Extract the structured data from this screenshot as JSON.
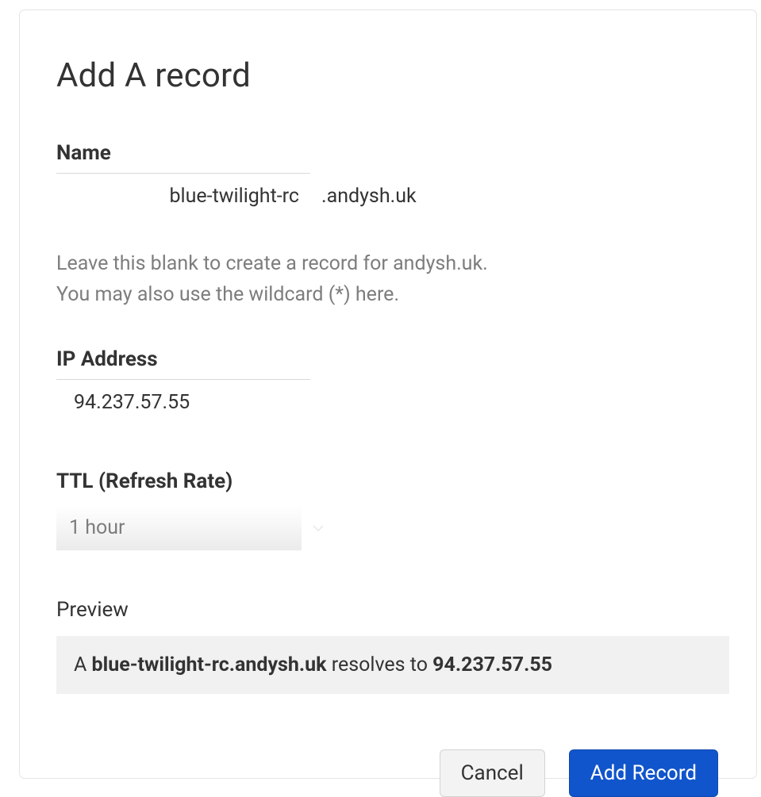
{
  "title": "Add A record",
  "fields": {
    "name": {
      "label": "Name",
      "value": "blue-twilight-rc",
      "suffix": ".andysh.uk",
      "help": "Leave this blank to create a record for andysh.uk.\nYou may also use the wildcard (*) here."
    },
    "ip": {
      "label": "IP Address",
      "value": "94.237.57.55"
    },
    "ttl": {
      "label": "TTL (Refresh Rate)",
      "selected": "1 hour"
    }
  },
  "preview": {
    "label": "Preview",
    "prefix": "A ",
    "host": "blue-twilight-rc.andysh.uk",
    "middle": " resolves to ",
    "target": "94.237.57.55"
  },
  "buttons": {
    "cancel": "Cancel",
    "submit": "Add Record"
  }
}
